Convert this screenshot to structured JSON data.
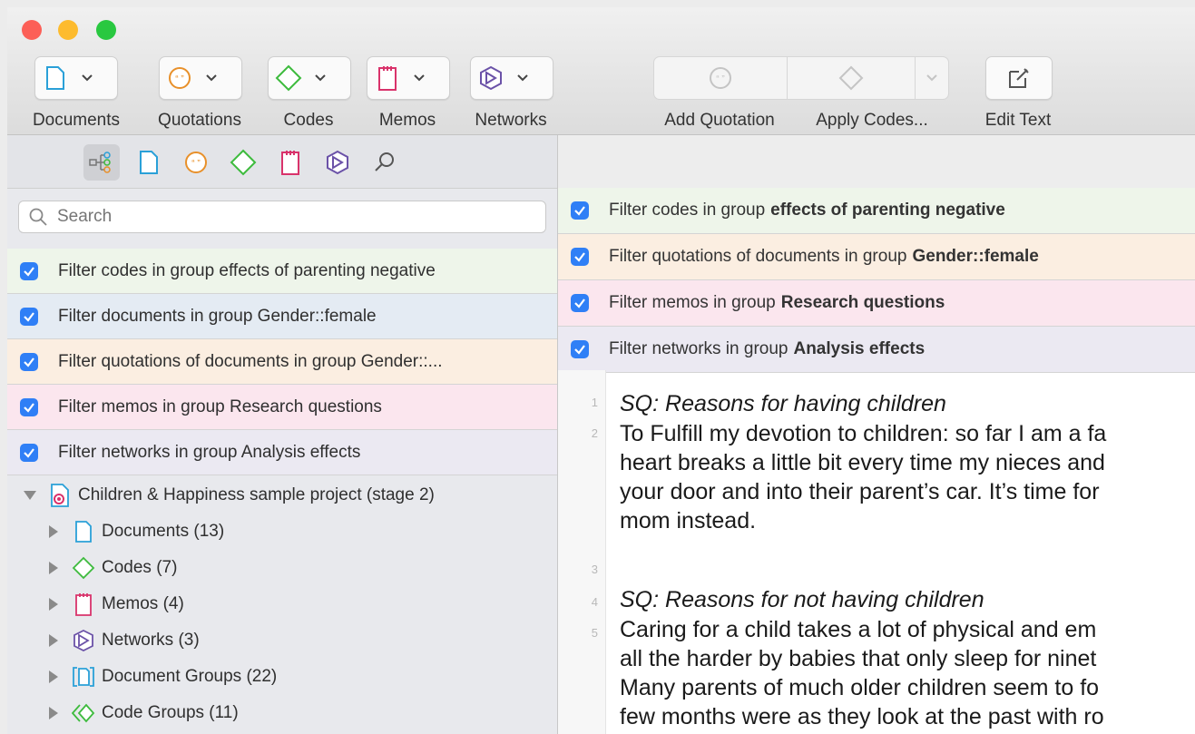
{
  "toolbar": {
    "buttons": [
      {
        "label": "Documents"
      },
      {
        "label": "Quotations"
      },
      {
        "label": "Codes"
      },
      {
        "label": "Memos"
      },
      {
        "label": "Networks"
      }
    ],
    "actions": {
      "add_quotation": "Add Quotation",
      "apply_codes": "Apply Codes...",
      "edit_text": "Edit Text"
    }
  },
  "search": {
    "placeholder": "Search"
  },
  "left_filters": [
    {
      "text": "Filter codes in group effects of parenting negative",
      "color": "#eef5ea"
    },
    {
      "text": "Filter documents in group Gender::female",
      "color": "#e4ebf3"
    },
    {
      "text": "Filter quotations of documents in group Gender::...",
      "color": "#fbeee1"
    },
    {
      "text": "Filter memos in group Research questions",
      "color": "#fbe6ee"
    },
    {
      "text": "Filter networks in group Analysis effects",
      "color": "#ebe9f2"
    }
  ],
  "tree": {
    "root": "Children & Happiness sample project (stage 2)",
    "items": [
      {
        "label": "Documents (13)",
        "icon": "document-icon"
      },
      {
        "label": "Codes (7)",
        "icon": "code-icon"
      },
      {
        "label": "Memos (4)",
        "icon": "memo-icon"
      },
      {
        "label": "Networks (3)",
        "icon": "network-icon"
      },
      {
        "label": "Document Groups (22)",
        "icon": "document-group-icon"
      },
      {
        "label": "Code Groups (11)",
        "icon": "code-group-icon"
      }
    ]
  },
  "right_filters": [
    {
      "prefix": "Filter codes in group",
      "bold": "effects of parenting negative",
      "color": "#eef5ea"
    },
    {
      "prefix": "Filter quotations of documents in group",
      "bold": "Gender::female",
      "color": "#fbeee1"
    },
    {
      "prefix": "Filter memos in group",
      "bold": "Research questions",
      "color": "#fbe6ee"
    },
    {
      "prefix": "Filter networks in group",
      "bold": "Analysis effects",
      "color": "#ebe9f2"
    }
  ],
  "document": {
    "line_numbers": [
      "1",
      "2",
      "3",
      "4",
      "5"
    ],
    "lines": [
      "SQ: Reasons for having children",
      "To Fulfill my devotion to children: so far I am a fa",
      "heart breaks a little bit every time my nieces and",
      "your door and into their parent’s car. It’s time for",
      "mom instead.",
      "SQ: Reasons for not having children",
      "Caring for a child takes a lot of physical and em",
      "all the harder by babies that only sleep for ninet",
      "Many parents of much older children seem to fo",
      "few months were as they look at the past with ro"
    ]
  },
  "colors": {
    "codes": "#3dbb3d",
    "documents": "#2aa0d8",
    "quotations": "#e8902a",
    "memos": "#d9336b",
    "networks": "#6b52a8",
    "checkbox": "#2f7ff6"
  }
}
